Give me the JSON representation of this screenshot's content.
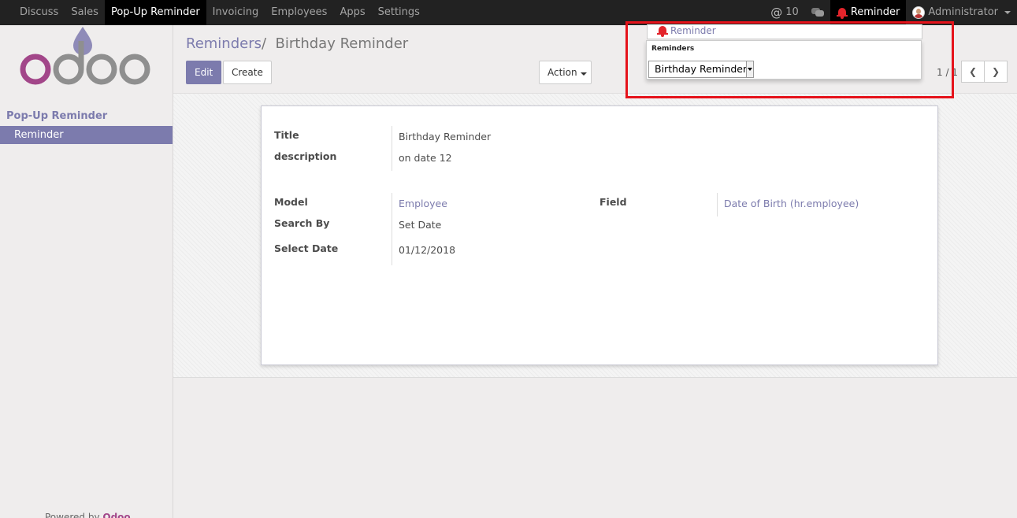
{
  "topbar": {
    "menu": [
      "Discuss",
      "Sales",
      "Pop-Up Reminder",
      "Invoicing",
      "Employees",
      "Apps",
      "Settings"
    ],
    "active_menu": "Pop-Up Reminder",
    "mentions_count": "10",
    "reminder_label": "Reminder",
    "user_name": "Administrator"
  },
  "sidebar": {
    "section": "Pop-Up Reminder",
    "selected_item": "Reminder",
    "powered_by": "Powered by",
    "powered_brand": "Odoo"
  },
  "control_panel": {
    "breadcrumb_parent": "Reminders",
    "breadcrumb_sep": "/",
    "breadcrumb_current": "Birthday Reminder",
    "edit_label": "Edit",
    "create_label": "Create",
    "action_label": "Action",
    "pager": "1 / 1"
  },
  "form": {
    "title_label": "Title",
    "title_value": "Birthday Reminder",
    "description_label": "description",
    "description_value": "on date 12",
    "model_label": "Model",
    "model_value": "Employee",
    "field_label": "Field",
    "field_value": "Date of Birth (hr.employee)",
    "search_by_label": "Search By",
    "search_by_value": "Set Date",
    "select_date_label": "Select Date",
    "select_date_value": "01/12/2018"
  },
  "reminder_popup": {
    "top_label": "Reminder",
    "header": "Reminders",
    "selected": "Birthday Reminder"
  },
  "colors": {
    "accent": "#7c7bad",
    "highlight": "#e5131b",
    "bell": "#e3242b",
    "logo_pink": "#a24689",
    "logo_grey": "#8f8f8f"
  }
}
